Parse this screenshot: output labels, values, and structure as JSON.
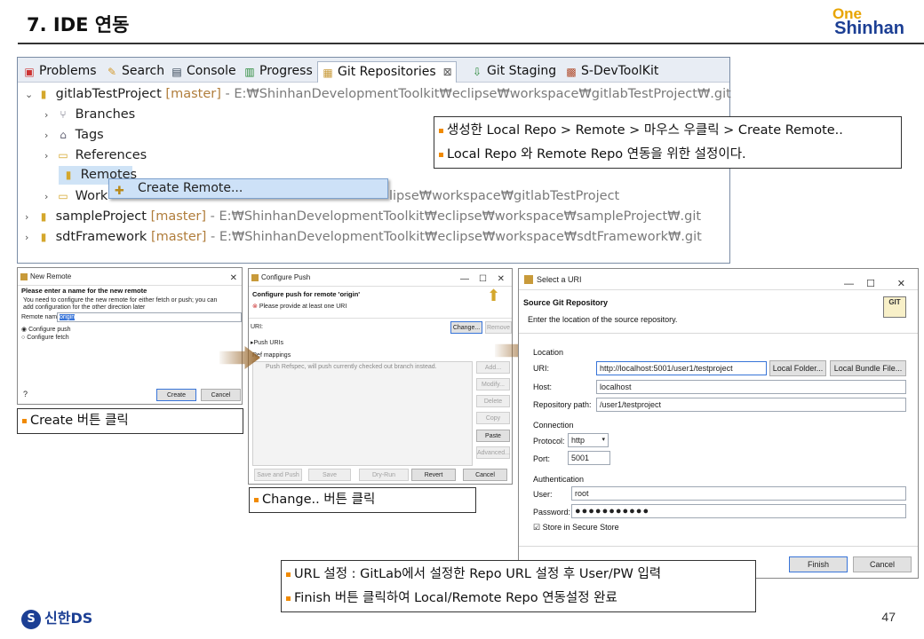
{
  "header": {
    "title": "7. IDE 연동",
    "logo_top": "One",
    "logo_bottom": "Shinhan"
  },
  "eclipse": {
    "tabs": [
      {
        "label": "Problems",
        "icon": "problems-icon"
      },
      {
        "label": "Search",
        "icon": "search-icon"
      },
      {
        "label": "Console",
        "icon": "console-icon"
      },
      {
        "label": "Progress",
        "icon": "progress-icon"
      },
      {
        "label": "Git Repositories",
        "icon": "git-repo-icon",
        "active": true
      },
      {
        "label": "Git Staging",
        "icon": "git-staging-icon"
      },
      {
        "label": "S-DevToolKit",
        "icon": "devtoolkit-icon"
      }
    ],
    "tab_close": "⊠",
    "tree": {
      "repo1_name": "gitlabTestProject",
      "repo1_branch": "[master]",
      "repo1_path": "- E:₩ShinhanDevelopmentToolkit₩eclipse₩workspace₩gitlabTestProject₩.git",
      "branches": "Branches",
      "tags": "Tags",
      "references": "References",
      "remotes": "Remotes",
      "working_prefix": "Work",
      "working_path": "lipse₩workspace₩gitlabTestProject",
      "repo2_name": "sampleProject",
      "repo2_branch": "[master]",
      "repo2_path": "- E:₩ShinhanDevelopmentToolkit₩eclipse₩workspace₩sampleProject₩.git",
      "repo3_name": "sdtFramework",
      "repo3_branch": "[master]",
      "repo3_path": "- E:₩ShinhanDevelopmentToolkit₩eclipse₩workspace₩sdtFramework₩.git"
    },
    "context_menu_item": "Create Remote..."
  },
  "callouts": {
    "top": [
      "생성한 Local Repo > Remote > 마우스 우클릭 > Create Remote..",
      "Local Repo 와 Remote Repo 연동을 위한 설정이다."
    ],
    "create": "Create 버튼 클릭",
    "change": "Change.. 버튼 클릭",
    "bottom": [
      "URL 설정 : GitLab에서 설정한 Repo URL 설정 후 User/PW 입력",
      "Finish 버튼 클릭하여 Local/Remote Repo 연동설정 완료"
    ]
  },
  "new_remote": {
    "title": "New Remote",
    "heading": "Please enter a name for the new remote",
    "desc1": "You need to configure the new remote for either fetch or push; you can",
    "desc2": "add configuration for the other direction later",
    "name_label": "Remote name:",
    "name_value": "origin",
    "opt_push": "Configure push",
    "opt_fetch": "Configure fetch",
    "create": "Create",
    "cancel": "Cancel",
    "help": "?"
  },
  "configure_push": {
    "title": "Configure Push",
    "heading": "Configure push for remote 'origin'",
    "error": "Please provide at least one URI",
    "uri_label": "URI:",
    "change": "Change...",
    "remove": "Remove",
    "push_uris": "Push URIs",
    "ref_mappings": "Ref mappings",
    "refspec_note": "Push Refspec, will push currently checked out branch instead.",
    "side_buttons": [
      "Add...",
      "Modify...",
      "Delete",
      "Copy",
      "Paste",
      "Advanced..."
    ],
    "bottom_buttons": [
      "Save and Push",
      "Save",
      "Dry-Run",
      "Revert",
      "Cancel"
    ]
  },
  "select_uri": {
    "title": "Select a URI",
    "heading": "Source Git Repository",
    "subtitle": "Enter the location of the source repository.",
    "git_badge": "GIT",
    "location": "Location",
    "uri_label": "URI:",
    "uri_value": "http://localhost:5001/user1/testproject",
    "local_folder": "Local Folder...",
    "local_bundle": "Local Bundle File...",
    "host_label": "Host:",
    "host_value": "localhost",
    "repo_path_label": "Repository path:",
    "repo_path_value": "/user1/testproject",
    "connection": "Connection",
    "protocol_label": "Protocol:",
    "protocol_value": "http",
    "port_label": "Port:",
    "port_value": "5001",
    "authentication": "Authentication",
    "user_label": "User:",
    "user_value": "root",
    "password_label": "Password:",
    "password_value": "●●●●●●●●●●●",
    "store": "Store in Secure Store",
    "finish": "Finish",
    "cancel": "Cancel"
  },
  "footer": {
    "logo": "신한DS",
    "page": "47"
  },
  "colors": {
    "brand_blue": "#1c3f94",
    "brand_orange": "#f08a00",
    "branch_text": "#b07d3b"
  }
}
